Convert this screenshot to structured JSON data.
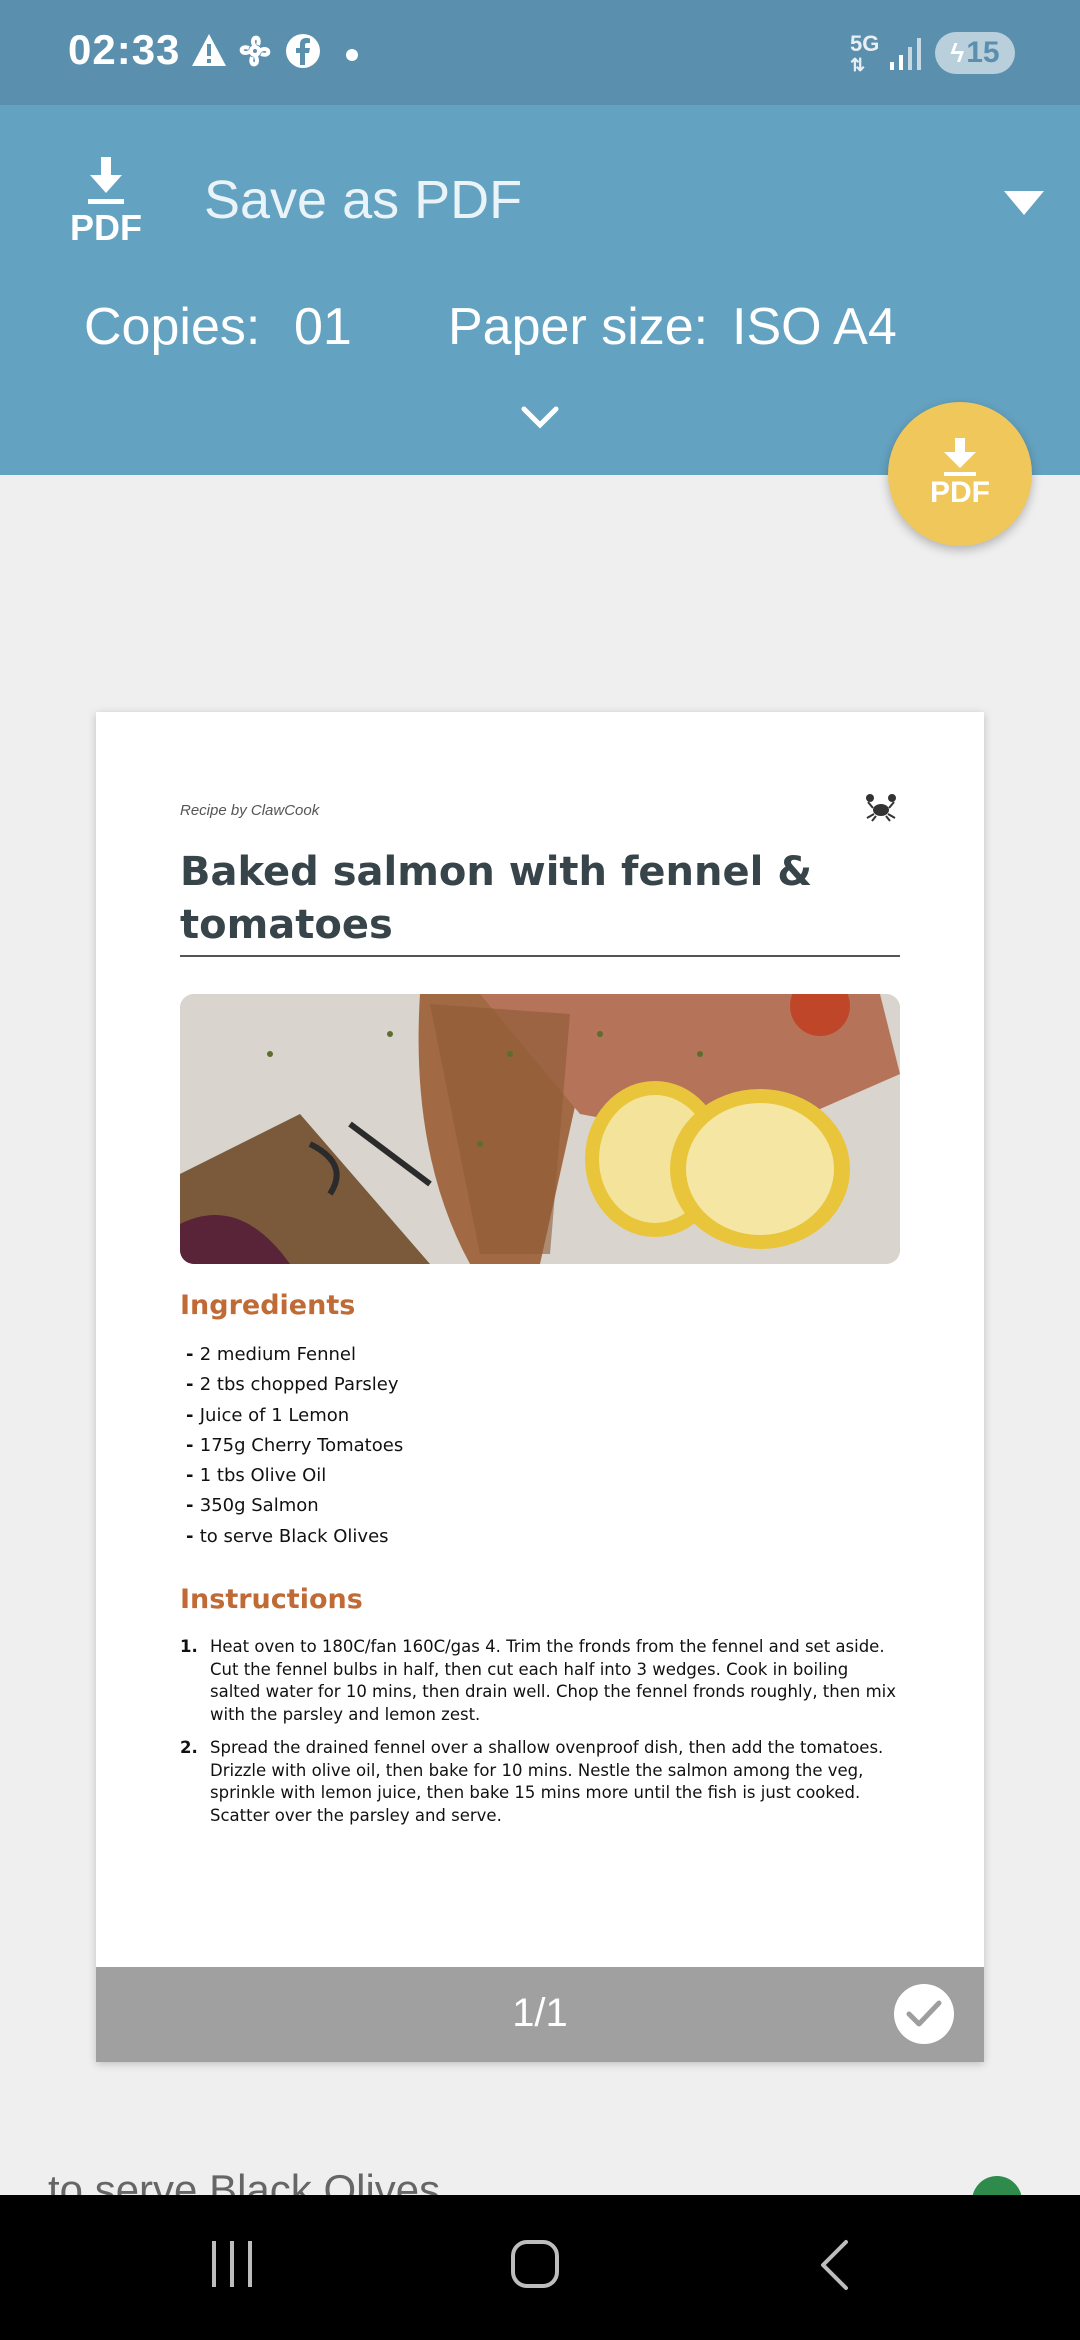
{
  "status_bar": {
    "time": "02:33",
    "network": "5G",
    "battery": "15",
    "icons": [
      "warning-icon",
      "fan-icon",
      "facebook-icon",
      "dot-icon",
      "signal-icon",
      "charging-icon"
    ]
  },
  "header": {
    "logo_text": "PDF",
    "title": "Save as PDF",
    "copies_label": "Copies:",
    "copies_value": "01",
    "paper_label": "Paper size:",
    "paper_value": "ISO A4",
    "accent_color": "#64a2c1"
  },
  "fab": {
    "label": "PDF",
    "color": "#f0c75a"
  },
  "document": {
    "byline": "Recipe by ClawCook",
    "title": "Baked salmon with fennel & tomatoes",
    "ingredients_heading": "Ingredients",
    "ingredients": [
      "2 medium Fennel",
      "2 tbs chopped Parsley",
      "Juice of 1 Lemon",
      "175g Cherry Tomatoes",
      "1 tbs Olive Oil",
      "350g Salmon",
      "to serve Black Olives"
    ],
    "instructions_heading": "Instructions",
    "instructions": [
      {
        "num": "1.",
        "text": "Heat oven to 180C/fan 160C/gas 4. Trim the fronds from the fennel and set aside. Cut the fennel bulbs in half, then cut each half into 3 wedges. Cook in boiling salted water for 10 mins, then drain well. Chop the fennel fronds roughly, then mix with the parsley and lemon zest."
      },
      {
        "num": "2.",
        "text": "Spread the drained fennel over a shallow ovenproof dish, then add the tomatoes. Drizzle with olive oil, then bake for 10 mins. Nestle the salmon among the veg, sprinkle with lemon juice, then bake 15 mins more until the fish is just cooked. Scatter over the parsley and serve."
      }
    ],
    "heading_color": "#c06a35"
  },
  "page_footer": {
    "indicator": "1/1"
  },
  "background_peek": {
    "text": "to serve Black Olives"
  }
}
